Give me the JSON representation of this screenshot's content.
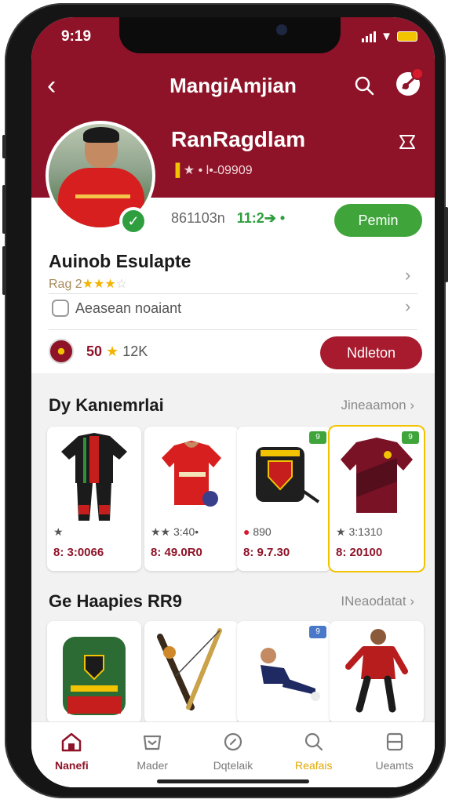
{
  "status_bar": {
    "time": "9:19"
  },
  "header": {
    "title": "MangiAmjian"
  },
  "profile": {
    "name": "RanRagdlam",
    "sub_prefix": "▐",
    "sub_text": "★ • l•˗09909",
    "stats_number": "861103n",
    "stats_green": "11:2➔ •",
    "action_label": "Pemin"
  },
  "info": {
    "title": "Auinob Esulapte",
    "rating_prefix": "Rag 2",
    "stars_on": "★★★",
    "stars_off": "☆",
    "detail_label": "Aeasean noaiant",
    "club_count": "50",
    "club_followers": "12K",
    "club_button_label": "Ndleton"
  },
  "section1": {
    "title": "Dy Kanıemrlai",
    "link": "Jineaamon",
    "items": [
      {
        "meta1": "★",
        "meta2": "8: 3:0066"
      },
      {
        "meta1": "★★ 3:40•",
        "meta2": "8: 49.0R0"
      },
      {
        "meta1": "890",
        "meta2": "8: 9.7.30"
      },
      {
        "meta1": "★ 3:1310",
        "meta2": "8: 20100"
      }
    ],
    "tags": [
      "9",
      "9"
    ]
  },
  "section2": {
    "title": "Ge Haapies RR9",
    "link": "INeaodatat",
    "tag": "9"
  },
  "tabs": [
    {
      "label": "Nanefi"
    },
    {
      "label": "Mader"
    },
    {
      "label": "Dqtelaik"
    },
    {
      "label": "Reafais"
    },
    {
      "label": "Ueamts"
    }
  ],
  "colors": {
    "brand": "#8e1328",
    "accent_green": "#3fa53b",
    "accent_red": "#a81a2e",
    "star_gold": "#f2b400"
  },
  "icons": {
    "back": "chevron-left-icon",
    "search": "search-icon",
    "notification": "bell-icon",
    "share": "share-icon",
    "verified": "checkmark-icon"
  }
}
